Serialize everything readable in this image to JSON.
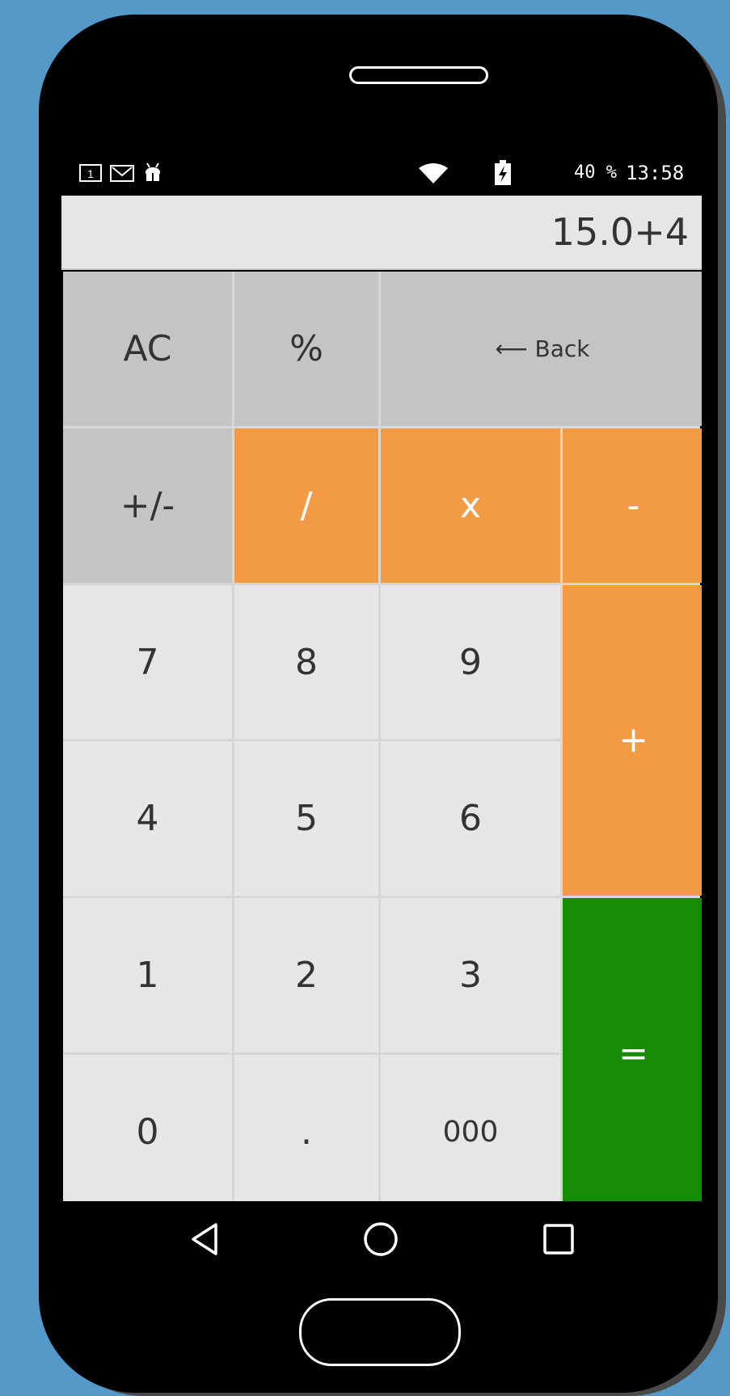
{
  "status_bar": {
    "battery": "40 %",
    "time": "13:58",
    "icons": [
      "sim-card-icon",
      "gmail-icon",
      "android-debug-icon",
      "wifi-icon",
      "battery-charging-icon"
    ]
  },
  "display": {
    "expression": "15.0+4"
  },
  "keys": {
    "ac": "AC",
    "percent": "%",
    "back": "⟵ Back",
    "plus_minus": "+/-",
    "divide": "/",
    "multiply": "x",
    "minus": "-",
    "seven": "7",
    "eight": "8",
    "nine": "9",
    "plus": "+",
    "four": "4",
    "five": "5",
    "six": "6",
    "one": "1",
    "two": "2",
    "three": "3",
    "equals": "=",
    "zero": "0",
    "dot": ".",
    "triple_zero": "000"
  },
  "colors": {
    "background": "#5599c9",
    "operator": "#f39a45",
    "equals": "#168c05",
    "function": "#c4c4c4",
    "digit": "#e6e6e6"
  },
  "nav_bar": {
    "icons": [
      "back-triangle-icon",
      "home-circle-icon",
      "recents-square-icon"
    ]
  }
}
